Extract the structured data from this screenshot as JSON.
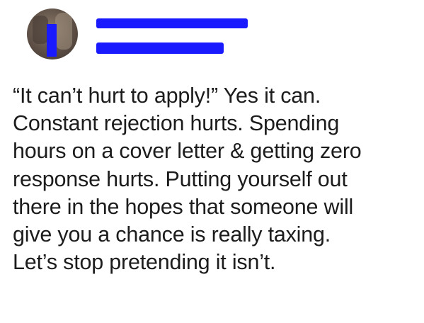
{
  "post": {
    "avatar_icon": "profile-photo",
    "redaction_color": "#1a1aff",
    "lines": [
      "“It can’t hurt to apply!” Yes it can.",
      "Constant rejection hurts. Spending",
      "hours on a cover letter & getting zero",
      "response hurts. Putting yourself out",
      "there in the hopes that someone will",
      "give you a chance is really taxing.",
      "Let’s stop pretending it isn’t."
    ]
  }
}
